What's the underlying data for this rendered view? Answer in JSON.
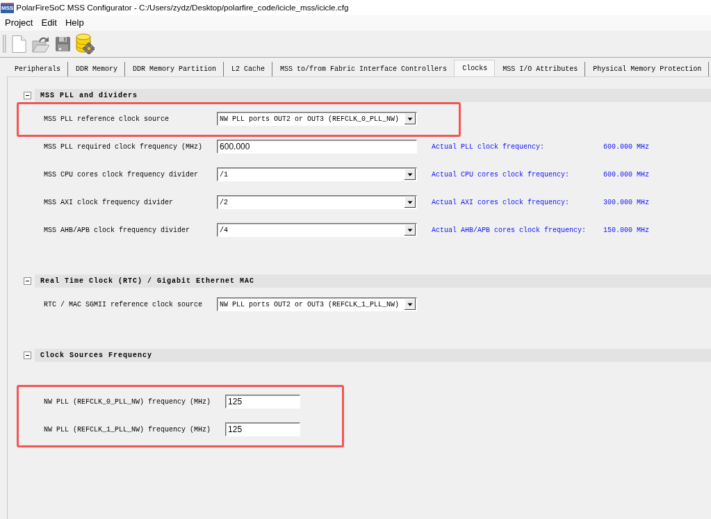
{
  "window": {
    "app_icon_text": "MSS",
    "title": "PolarFireSoC MSS Configurator - C:/Users/zydz/Desktop/polarfire_code/icicle_mss/icicle.cfg"
  },
  "menu": [
    "Project",
    "Edit",
    "Help"
  ],
  "toolbar": [
    {
      "kind": "new"
    },
    {
      "kind": "open"
    },
    {
      "kind": "save"
    },
    {
      "kind": "configure"
    }
  ],
  "tabs": [
    {
      "label": "Peripherals",
      "selected": false
    },
    {
      "label": "DDR Memory",
      "selected": false
    },
    {
      "label": "DDR Memory Partition",
      "selected": false
    },
    {
      "label": "L2 Cache",
      "selected": false
    },
    {
      "label": "MSS to/from Fabric Interface Controllers",
      "selected": false
    },
    {
      "label": "Clocks",
      "selected": true
    },
    {
      "label": "MSS I/O Attributes",
      "selected": false
    },
    {
      "label": "Physical Memory Protection",
      "selected": false
    }
  ],
  "sections": [
    {
      "title": "MSS PLL and dividers",
      "expanded": true,
      "rows": [
        {
          "kind": "dropdown",
          "label": "MSS PLL reference clock source",
          "value": "NW PLL ports OUT2 or OUT3 (REFCLK_0_PLL_NW)",
          "highlighted": true
        },
        {
          "kind": "text",
          "label": "MSS PLL required clock frequency (MHz)",
          "value": "600.000",
          "actual_label": "Actual PLL clock frequency:",
          "actual_value": "600.000 MHz",
          "highlighted": false
        },
        {
          "kind": "dropdown",
          "label": "MSS CPU cores clock frequency divider",
          "value": "/1",
          "actual_label": "Actual CPU cores clock frequency:",
          "actual_value": "600.000 MHz",
          "highlighted": false
        },
        {
          "kind": "dropdown",
          "label": "MSS AXI clock frequency divider",
          "value": "/2",
          "actual_label": "Actual AXI cores clock frequency:",
          "actual_value": "300.000 MHz",
          "highlighted": false
        },
        {
          "kind": "dropdown",
          "label": "MSS AHB/APB clock frequency divider",
          "value": "/4",
          "actual_label": "Actual AHB/APB cores clock frequency:",
          "actual_value": "150.000 MHz",
          "highlighted": false
        }
      ]
    },
    {
      "title": "Real Time Clock (RTC) / Gigabit Ethernet MAC",
      "expanded": true,
      "rows": [
        {
          "kind": "dropdown",
          "label": "RTC / MAC SGMII reference clock source",
          "value": "NW PLL ports OUT2 or OUT3 (REFCLK_1_PLL_NW)",
          "highlighted": false
        }
      ]
    },
    {
      "title": "Clock Sources Frequency",
      "expanded": true,
      "rows": [
        {
          "kind": "frequency",
          "label": "NW PLL (REFCLK_0_PLL_NW) frequency (MHz)",
          "value": "125",
          "highlighted": true
        },
        {
          "kind": "frequency",
          "label": "NW PLL (REFCLK_1_PLL_NW) frequency (MHz)",
          "value": "125",
          "highlighted": true
        }
      ]
    }
  ]
}
